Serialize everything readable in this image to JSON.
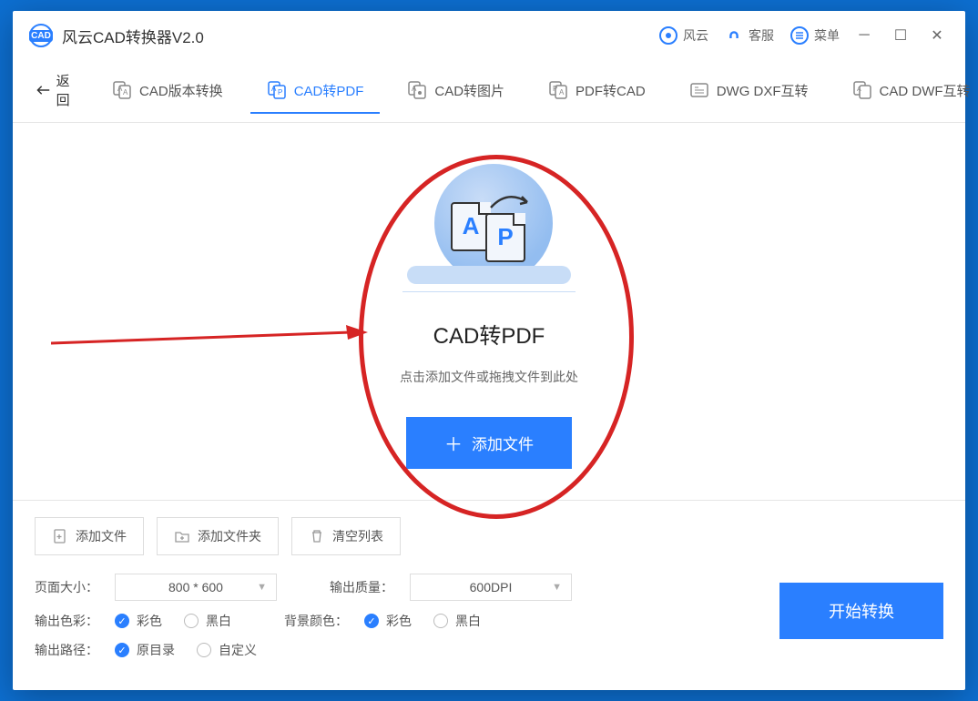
{
  "app": {
    "title": "风云CAD转换器V2.0"
  },
  "titlebar": {
    "fengyun": "风云",
    "kefu": "客服",
    "menu": "菜单"
  },
  "toolbar": {
    "back": "返回",
    "tabs": [
      {
        "label": "CAD版本转换"
      },
      {
        "label": "CAD转PDF"
      },
      {
        "label": "CAD转图片"
      },
      {
        "label": "PDF转CAD"
      },
      {
        "label": "DWG DXF互转"
      },
      {
        "label": "CAD DWF互转"
      }
    ]
  },
  "hero": {
    "docA": "A",
    "docP": "P",
    "title": "CAD转PDF",
    "subtitle": "点击添加文件或拖拽文件到此处",
    "addBtn": "添加文件"
  },
  "panel": {
    "addFile": "添加文件",
    "addFolder": "添加文件夹",
    "clearList": "清空列表",
    "pageSizeLabel": "页面大小：",
    "pageSizeValue": "800 * 600",
    "qualityLabel": "输出质量：",
    "qualityValue": "600DPI",
    "colorLabel": "输出色彩：",
    "colorOpt1": "彩色",
    "colorOpt2": "黑白",
    "bgLabel": "背景颜色：",
    "bgOpt1": "彩色",
    "bgOpt2": "黑白",
    "pathLabel": "输出路径：",
    "pathOpt1": "原目录",
    "pathOpt2": "自定义",
    "convert": "开始转换"
  }
}
